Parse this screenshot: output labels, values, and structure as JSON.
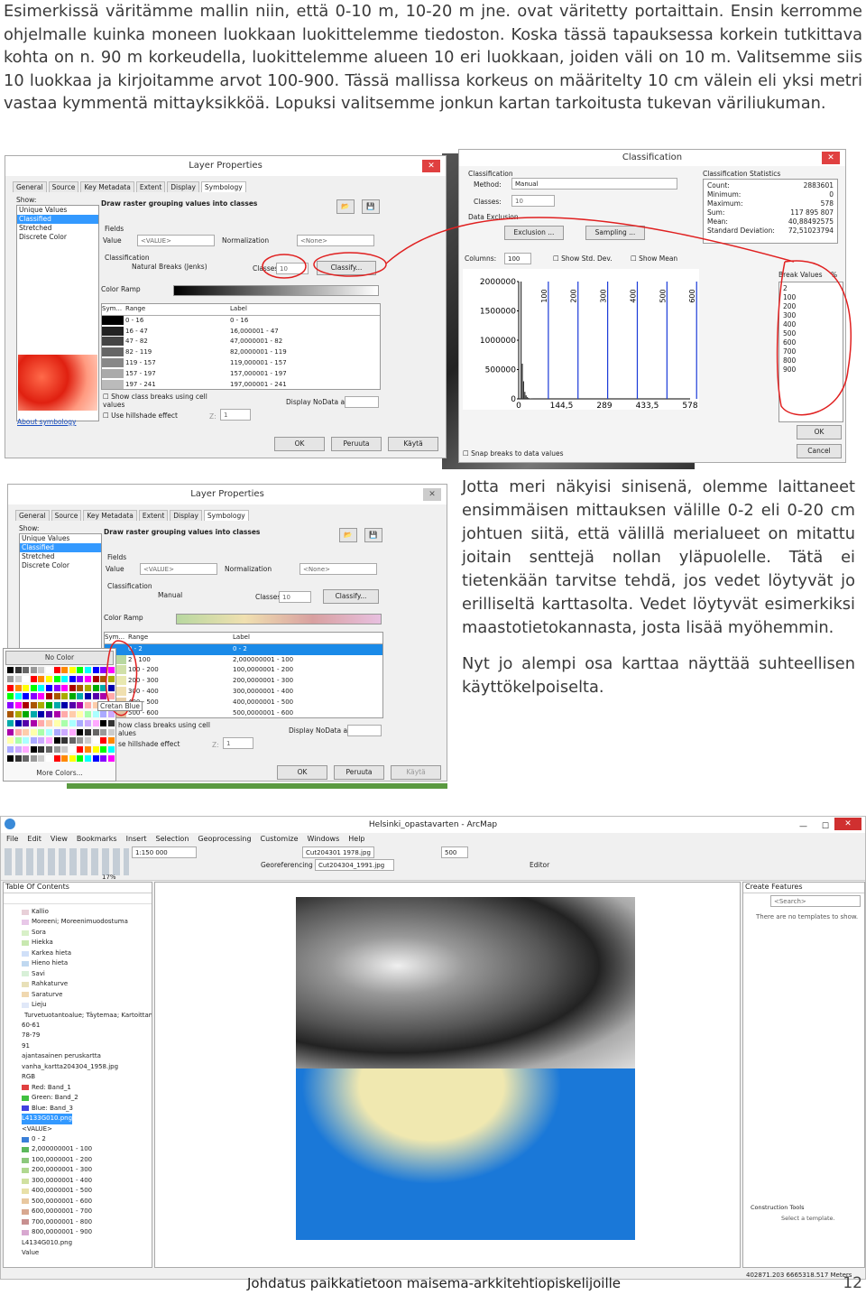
{
  "intro_text": "Esimerkissä väritämme mallin niin, että 0-10 m, 10-20 m jne. ovat väritetty portaittain. Ensin kerromme ohjelmalle kuinka moneen luokkaan luokittelemme tiedoston. Koska tässä tapauksessa korkein tutkittava kohta on n. 90 m korkeudella, luokittelemme alueen 10 eri luokkaan, joiden väli on 10 m. Valitsemme siis 10 luokkaa ja kirjoitamme arvot 100-900. Tässä mallissa korkeus on määritelty 10 cm välein eli yksi metri vastaa kymmentä mittayksikköä. Lopuksi valitsemme jonkun kartan tarkoitusta tukevan väriliukuman.",
  "lp1": {
    "title": "Layer Properties",
    "close": "✕",
    "tabs": [
      "General",
      "Source",
      "Key Metadata",
      "Extent",
      "Display",
      "Symbology"
    ],
    "show_label": "Show:",
    "show_items": [
      "Unique Values",
      "Classified",
      "Stretched",
      "Discrete Color"
    ],
    "draw_label": "Draw raster grouping values into classes",
    "fields_label": "Fields",
    "value_label": "Value",
    "value_dd": "<VALUE>",
    "normalization_label": "Normalization",
    "norm_dd": "<None>",
    "classification_label": "Classification",
    "method_text": "Natural Breaks (Jenks)",
    "classes_label": "Classes",
    "classes_value": "10",
    "classify_btn": "Classify...",
    "color_ramp_label": "Color Ramp",
    "col_sym": "Sym...",
    "col_range": "Range",
    "col_label": "Label",
    "rows": [
      {
        "range": "0 - 16",
        "label": "0 - 16"
      },
      {
        "range": "16 - 47",
        "label": "16,000001 - 47"
      },
      {
        "range": "47 - 82",
        "label": "47,0000001 - 82"
      },
      {
        "range": "82 - 119",
        "label": "82,0000001 - 119"
      },
      {
        "range": "119 - 157",
        "label": "119,000001 - 157"
      },
      {
        "range": "157 - 197",
        "label": "157,000001 - 197"
      },
      {
        "range": "197 - 241",
        "label": "197,000001 - 241"
      }
    ],
    "show_breaks": "Show class breaks using cell values",
    "hillshade": "Use hillshade effect",
    "z_label": "Z:",
    "z_value": "1",
    "nodata_label": "Display NoData as",
    "about": "About symbology",
    "ok": "OK",
    "cancel": "Peruuta",
    "apply": "Käytä"
  },
  "cls": {
    "title": "Classification",
    "close": "✕",
    "classification_label": "Classification",
    "method_label": "Method:",
    "method_value": "Manual",
    "classes_label": "Classes:",
    "classes_value": "10",
    "data_exclusion": "Data Exclusion",
    "exclusion_btn": "Exclusion ...",
    "sampling_btn": "Sampling ...",
    "columns_label": "Columns:",
    "columns_value": "100",
    "show_std": "Show Std. Dev.",
    "show_mean": "Show Mean",
    "stats_title": "Classification Statistics",
    "stats": [
      {
        "k": "Count:",
        "v": "2883601"
      },
      {
        "k": "Minimum:",
        "v": "0"
      },
      {
        "k": "Maximum:",
        "v": "578"
      },
      {
        "k": "Sum:",
        "v": "117 895 807"
      },
      {
        "k": "Mean:",
        "v": "40,88492575"
      },
      {
        "k": "Standard Deviation:",
        "v": "72,51023794"
      }
    ],
    "break_values_label": "Break Values",
    "pct": "%",
    "break_values": [
      "2",
      "100",
      "200",
      "300",
      "400",
      "500",
      "600",
      "700",
      "800",
      "900"
    ],
    "snap": "Snap breaks to data values",
    "ok": "OK",
    "cancel": "Cancel"
  },
  "chart_data": {
    "type": "bar",
    "title": "",
    "y_ticks": [
      "2000000",
      "1500000",
      "1000000",
      "500000",
      "0"
    ],
    "x_ticks": [
      "0",
      "144,5",
      "289",
      "433,5",
      "578"
    ],
    "break_labels": [
      "100",
      "200",
      "300",
      "400",
      "500",
      "600"
    ],
    "ylim": [
      0,
      2000000
    ],
    "xlim": [
      0,
      578
    ],
    "series": [
      {
        "values": [
          2000000,
          600000,
          300000,
          120000,
          60000,
          30000,
          15000,
          8000,
          4000,
          2000
        ]
      }
    ]
  },
  "lp2": {
    "title": "Layer Properties",
    "close": "✕",
    "tabs": [
      "General",
      "Source",
      "Key Metadata",
      "Extent",
      "Display",
      "Symbology"
    ],
    "show_label": "Show:",
    "show_items": [
      "Unique Values",
      "Classified",
      "Stretched",
      "Discrete Color"
    ],
    "draw_label": "Draw raster grouping values into classes",
    "fields_label": "Fields",
    "value_label": "Value",
    "value_dd": "<VALUE>",
    "normalization_label": "Normalization",
    "norm_dd": "<None>",
    "classification_label": "Classification",
    "method_text": "Manual",
    "classes_label": "Classes",
    "classes_value": "10",
    "classify_btn": "Classify...",
    "color_ramp_label": "Color Ramp",
    "col_sym": "Sym...",
    "col_range": "Range",
    "col_label": "Label",
    "rows": [
      {
        "range": "0 - 2",
        "label": "0 - 2"
      },
      {
        "range": "2 - 100",
        "label": "2,000000001 - 100"
      },
      {
        "range": "100 - 200",
        "label": "100,0000001 - 200"
      },
      {
        "range": "200 - 300",
        "label": "200,0000001 - 300"
      },
      {
        "range": "300 - 400",
        "label": "300,0000001 - 400"
      },
      {
        "range": "400 - 500",
        "label": "400,0000001 - 500"
      },
      {
        "range": "500 - 600",
        "label": "500,0000001 - 600"
      }
    ],
    "show_breaks": "how class breaks using cell alues",
    "hillshade": "se hillshade effect",
    "z_label": "Z:",
    "z_value": "1",
    "nodata_label": "Display NoData as",
    "ok": "OK",
    "cancel": "Peruuta",
    "apply": "Käytä",
    "no_color": "No Color",
    "tooltip": "Cretan Blue",
    "more_colors": "More Colors..."
  },
  "side_text": [
    "Jotta meri näkyisi sinisenä, olemme laittaneet ensimmäisen mittauksen välille 0-2 eli 0-20 cm johtuen siitä, että välillä merialueet on mitattu joitain senttejä nollan yläpuolelle. Tätä ei tietenkään tarvitse tehdä, jos vedet löytyvät jo erilliseltä karttasolta. Vedet löytyvät esimerkiksi maastotietokannasta, josta lisää myöhemmin.",
    "Nyt jo alempi osa karttaa näyttää suhteellisen käyttökelpoiselta."
  ],
  "arcmap": {
    "title": "Helsinki_opastavarten - ArcMap",
    "menu": [
      "File",
      "Edit",
      "View",
      "Bookmarks",
      "Insert",
      "Selection",
      "Geoprocessing",
      "Customize",
      "Windows",
      "Help"
    ],
    "scale": "1:150 000",
    "layer_dd": "Cut204301 1978.jpg",
    "value_500": "500",
    "georef_label": "Georeferencing",
    "georef_dd": "Cut204304_1991.jpg",
    "editor": "Editor",
    "zoom": "17%",
    "toc_title": "Table Of Contents",
    "toc_items": [
      {
        "t": "Kallio",
        "c": "#e8d0d8"
      },
      {
        "t": "Moreeni; Moreenimuodostuma",
        "c": "#e8c8e8"
      },
      {
        "t": "Sora",
        "c": "#d8f0c8"
      },
      {
        "t": "Hiekka",
        "c": "#c8e8b0"
      },
      {
        "t": "Karkea hieta",
        "c": "#d0e0f8"
      },
      {
        "t": "Hieno hieta",
        "c": "#c0d8f0"
      },
      {
        "t": "Savi",
        "c": "#d8f0d8"
      },
      {
        "t": "Rahkaturve",
        "c": "#e8e0b8"
      },
      {
        "t": "Saraturve",
        "c": "#f0d8b0"
      },
      {
        "t": "Lieju",
        "c": "#e0e8f8"
      },
      {
        "t": "Turvetuotantoalue; Täytemaa; Kartoittamaton",
        "c": "#f0f0f0"
      },
      {
        "t": "60-61",
        "c": ""
      },
      {
        "t": "78-79",
        "c": ""
      },
      {
        "t": "91",
        "c": ""
      },
      {
        "t": "ajantasainen peruskartta",
        "c": ""
      },
      {
        "t": "vanha_kartta204304_1958.jpg",
        "c": ""
      },
      {
        "t": "RGB",
        "c": ""
      },
      {
        "t": "Red:  Band_1",
        "c": "#e04040"
      },
      {
        "t": "Green: Band_2",
        "c": "#40c040"
      },
      {
        "t": "Blue:  Band_3",
        "c": "#4040e0"
      },
      {
        "t": "L4133G010.png",
        "c": "",
        "sel": true
      },
      {
        "t": "<VALUE>",
        "c": ""
      },
      {
        "t": "0 - 2",
        "c": "#3a7fd8"
      },
      {
        "t": "2,000000001 - 100",
        "c": "#5cb85c"
      },
      {
        "t": "100,0000001 - 200",
        "c": "#8cc87c"
      },
      {
        "t": "200,0000001 - 300",
        "c": "#b0d890"
      },
      {
        "t": "300,0000001 - 400",
        "c": "#d0e0a0"
      },
      {
        "t": "400,0000001 - 500",
        "c": "#e8e0a8"
      },
      {
        "t": "500,0000001 - 600",
        "c": "#e8c8a0"
      },
      {
        "t": "600,0000001 - 700",
        "c": "#d8a890"
      },
      {
        "t": "700,0000001 - 800",
        "c": "#c89090"
      },
      {
        "t": "800,0000001 - 900",
        "c": "#d8a8d0"
      },
      {
        "t": "L4134G010.png",
        "c": ""
      },
      {
        "t": "Value",
        "c": ""
      }
    ],
    "cf_title": "Create Features",
    "cf_search": "<Search>",
    "cf_empty": "There are no templates to show.",
    "ct_title": "Construction Tools",
    "ct_text": "Select a template.",
    "coords": "402871.203  6665318.517 Meters"
  },
  "footer": "Johdatus paikkatietoon maisema-arkkitehtiopiskelijoille",
  "page_number": "12"
}
